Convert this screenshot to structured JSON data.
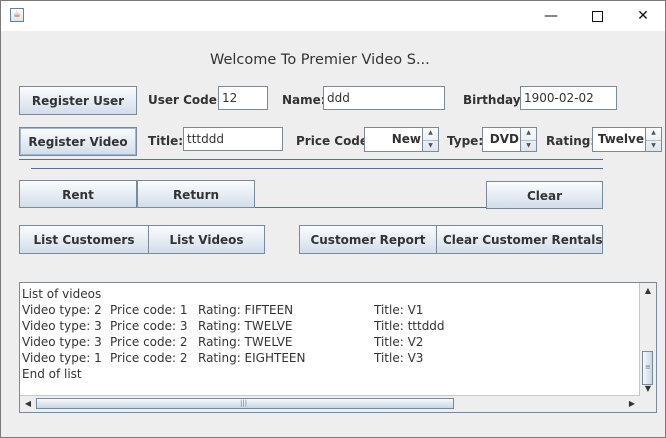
{
  "window": {
    "minimize_glyph": "—",
    "close_glyph": "✕"
  },
  "welcome_text": "Welcome To Premier Video S...",
  "user_row": {
    "register_user_label": "Register User",
    "user_code_label": "User Code:",
    "user_code_value": "12",
    "name_label": "Name:",
    "name_value": "ddd",
    "birthday_label": "Birthday:",
    "birthday_value": "1900-02-02"
  },
  "video_row": {
    "register_video_label": "Register Video",
    "title_label": "Title:",
    "title_value": "tttddd",
    "price_code_label": "Price Code:",
    "price_code_value": "New",
    "type_label": "Type:",
    "type_value": "DVD",
    "rating_label": "Rating:",
    "rating_value": "Twelve"
  },
  "actions": {
    "rent_label": "Rent",
    "return_label": "Return",
    "clear_label": "Clear",
    "list_customers_label": "List Customers",
    "list_videos_label": "List Videos",
    "customer_report_label": "Customer Report",
    "clear_customer_rentals_label": "Clear Customer Rentals"
  },
  "output": {
    "header": "List of videos",
    "rows": [
      {
        "type": "Video type: 2",
        "price": "Price code: 1",
        "rating": "Rating: FIFTEEN",
        "title": "Title: V1"
      },
      {
        "type": "Video type: 3",
        "price": "Price code: 3",
        "rating": "Rating: TWELVE",
        "title": "Title: tttddd"
      },
      {
        "type": "Video type: 3",
        "price": "Price code: 2",
        "rating": "Rating: TWELVE",
        "title": "Title: V2"
      },
      {
        "type": "Video type: 1",
        "price": "Price code: 2",
        "rating": "Rating: EIGHTEEN",
        "title": "Title: V3"
      }
    ],
    "footer": "End of list"
  },
  "colors": {
    "accent": "#5a6f8c",
    "button_border": "#7a8a99",
    "text": "#333333"
  }
}
